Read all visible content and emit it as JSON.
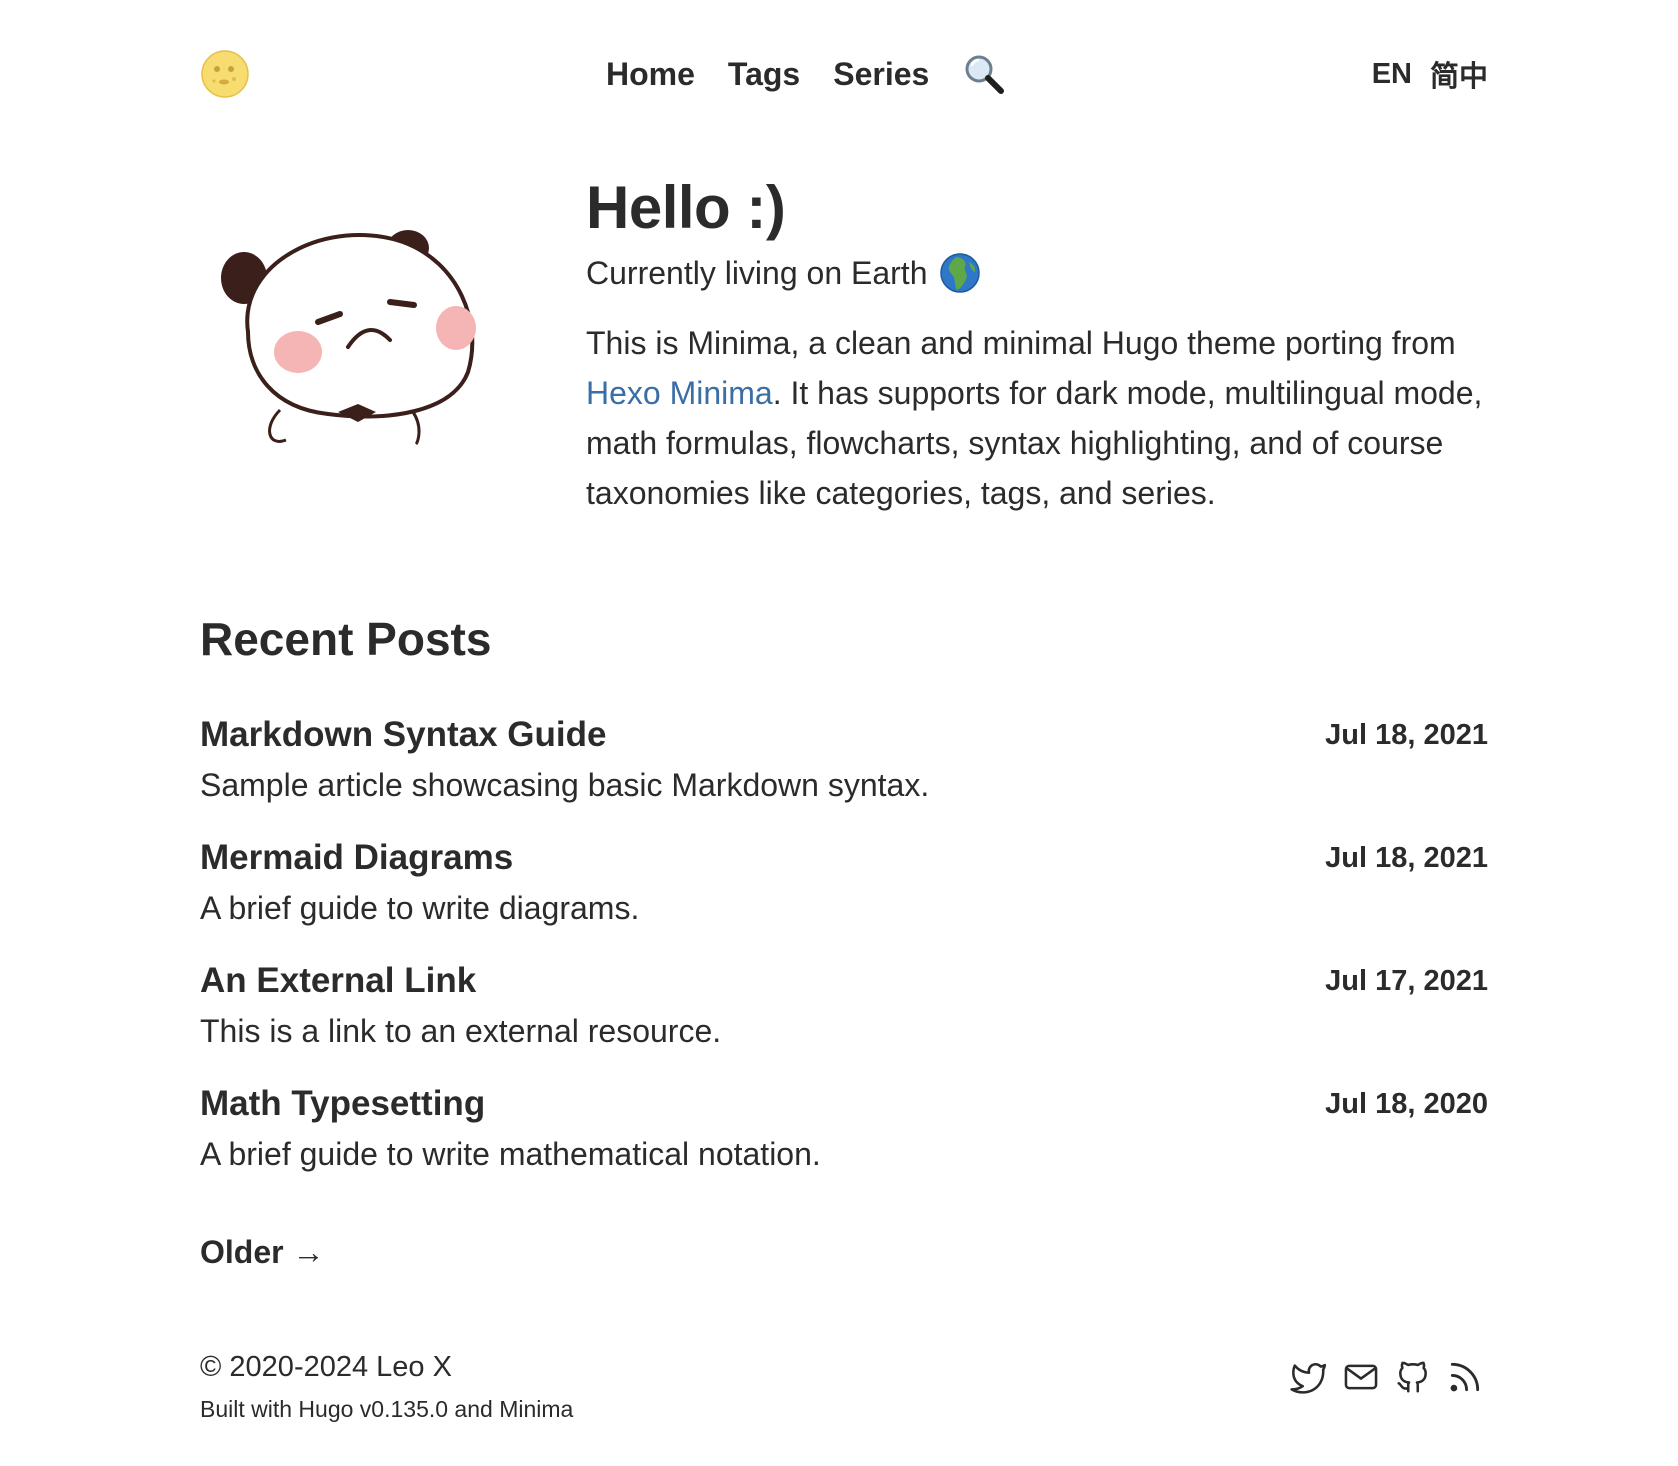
{
  "header": {
    "logo_icon": "full-moon-face-icon",
    "nav": [
      {
        "label": "Home"
      },
      {
        "label": "Tags"
      },
      {
        "label": "Series"
      }
    ],
    "search_icon": "search-icon",
    "languages": [
      "EN",
      "简中"
    ]
  },
  "intro": {
    "avatar_icon": "panda-avatar",
    "title": "Hello :)",
    "subtitle": "Currently living on Earth",
    "bio_before": "This is Minima, a clean and minimal Hugo theme porting from ",
    "bio_link": "Hexo Minima",
    "bio_after": ". It has supports for dark mode, multilingual mode, math formulas, flowcharts, syntax highlighting, and of course taxonomies like categories, tags, and series."
  },
  "recent": {
    "title": "Recent Posts",
    "posts": [
      {
        "title": "Markdown Syntax Guide",
        "description": "Sample article showcasing basic Markdown syntax.",
        "date": "Jul 18, 2021"
      },
      {
        "title": "Mermaid Diagrams",
        "description": "A brief guide to write diagrams.",
        "date": "Jul 18, 2021"
      },
      {
        "title": "An External Link",
        "description": "This is a link to an external resource.",
        "date": "Jul 17, 2021"
      },
      {
        "title": "Math Typesetting",
        "description": "A brief guide to write mathematical notation.",
        "date": "Jul 18, 2020"
      }
    ],
    "older_label": "Older →"
  },
  "footer": {
    "copyright": "© 2020-2024 Leo X",
    "built_with": "Built with Hugo v0.135.0 and Minima",
    "social_icons": [
      "twitter-icon",
      "mail-icon",
      "github-icon",
      "rss-icon"
    ]
  },
  "colors": {
    "text": "#2b2b2b",
    "link": "#3a6ea5",
    "background": "#ffffff"
  }
}
